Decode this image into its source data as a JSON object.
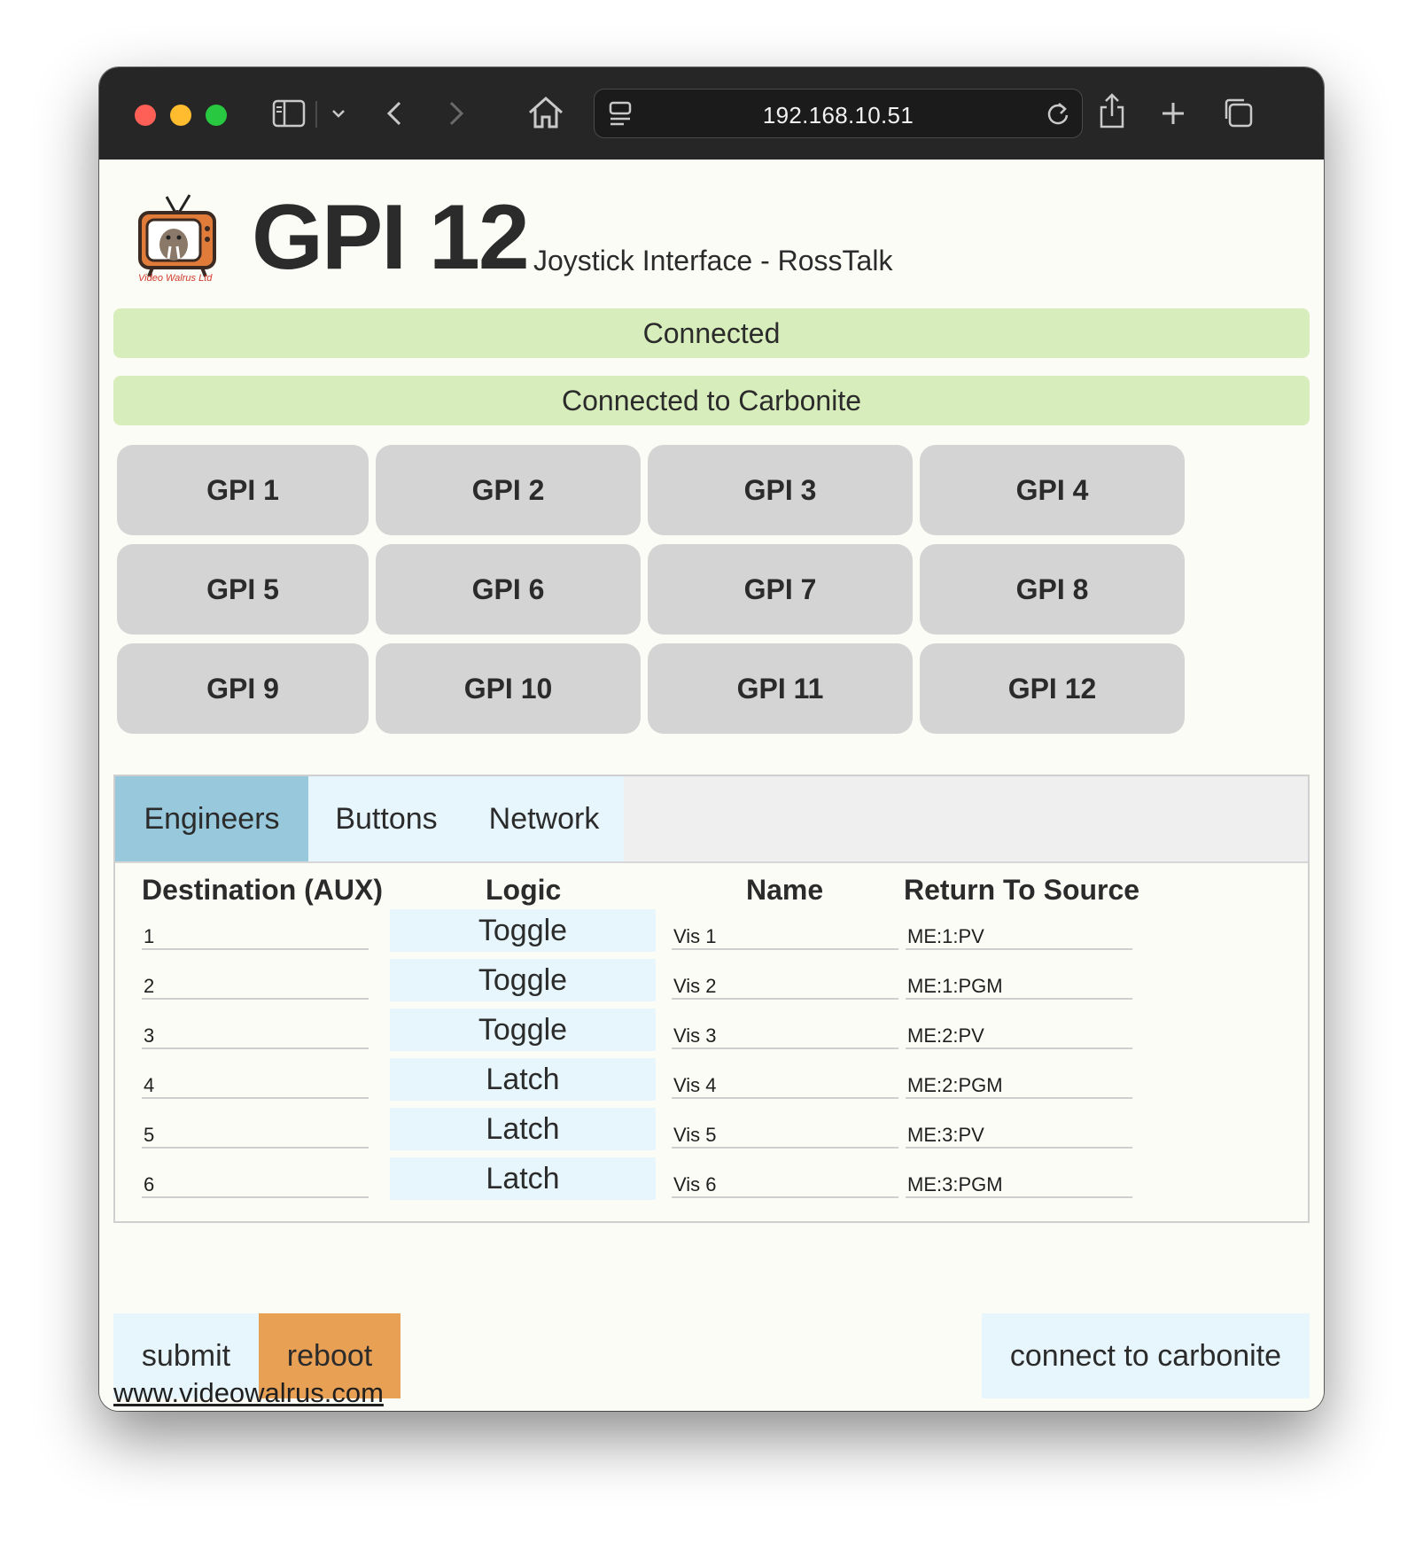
{
  "browser": {
    "url": "192.168.10.51"
  },
  "header": {
    "logo_text": "Video Walrus Ltd",
    "title": "GPI 12",
    "subtitle": "Joystick Interface - RossTalk"
  },
  "status": {
    "connection": "Connected",
    "carbonite": "Connected to Carbonite",
    "color": "#d7edbb"
  },
  "gpi_buttons": [
    {
      "label": "GPI 1"
    },
    {
      "label": "GPI 2"
    },
    {
      "label": "GPI 3"
    },
    {
      "label": "GPI 4"
    },
    {
      "label": "GPI 5"
    },
    {
      "label": "GPI 6"
    },
    {
      "label": "GPI 7"
    },
    {
      "label": "GPI 8"
    },
    {
      "label": "GPI 9"
    },
    {
      "label": "GPI 10"
    },
    {
      "label": "GPI 11"
    },
    {
      "label": "GPI 12"
    }
  ],
  "tabs": [
    {
      "label": "Engineers",
      "active": true
    },
    {
      "label": "Buttons",
      "active": false
    },
    {
      "label": "Network",
      "active": false
    }
  ],
  "table": {
    "headers": {
      "destination": "Destination (AUX)",
      "logic": "Logic",
      "name": "Name",
      "return_to_source": "Return To Source"
    },
    "rows": [
      {
        "destination": "1",
        "logic": "Toggle",
        "name": "Vis 1",
        "return": "ME:1:PV"
      },
      {
        "destination": "2",
        "logic": "Toggle",
        "name": "Vis 2",
        "return": "ME:1:PGM"
      },
      {
        "destination": "3",
        "logic": "Toggle",
        "name": "Vis 3",
        "return": "ME:2:PV"
      },
      {
        "destination": "4",
        "logic": "Latch",
        "name": "Vis 4",
        "return": "ME:2:PGM"
      },
      {
        "destination": "5",
        "logic": "Latch",
        "name": "Vis 5",
        "return": "ME:3:PV"
      },
      {
        "destination": "6",
        "logic": "Latch",
        "name": "Vis 6",
        "return": "ME:3:PGM"
      }
    ]
  },
  "actions": {
    "submit": "submit",
    "reboot": "reboot",
    "connect": "connect to carbonite",
    "reboot_color": "#e8a055"
  },
  "footer": {
    "link": "www.videowalrus.com"
  }
}
